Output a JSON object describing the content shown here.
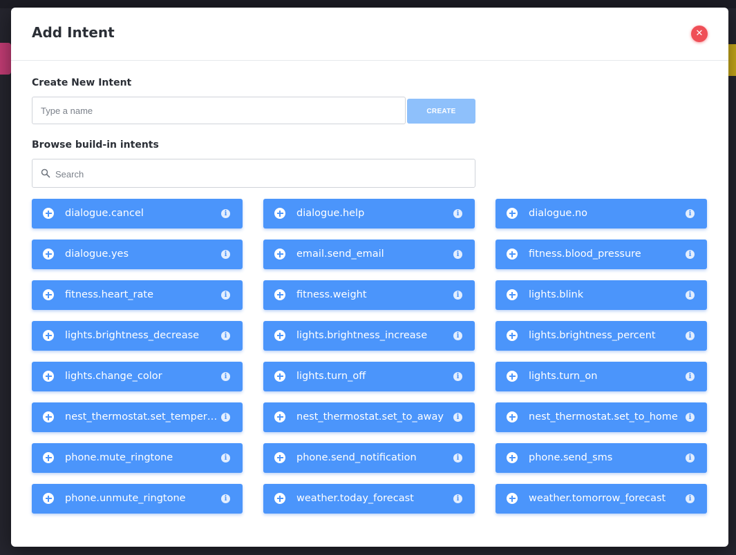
{
  "modal": {
    "title": "Add Intent",
    "close_icon": "close-icon",
    "create_section": {
      "label": "Create New Intent",
      "input_placeholder": "Type a name",
      "input_value": "",
      "button_label": "CREATE"
    },
    "browse_section": {
      "label": "Browse build-in intents",
      "search_placeholder": "Search",
      "search_value": "",
      "search_icon": "search-icon"
    },
    "intents": [
      {
        "label": "dialogue.cancel"
      },
      {
        "label": "dialogue.help"
      },
      {
        "label": "dialogue.no"
      },
      {
        "label": "dialogue.yes"
      },
      {
        "label": "email.send_email"
      },
      {
        "label": "fitness.blood_pressure"
      },
      {
        "label": "fitness.heart_rate"
      },
      {
        "label": "fitness.weight"
      },
      {
        "label": "lights.blink"
      },
      {
        "label": "lights.brightness_decrease"
      },
      {
        "label": "lights.brightness_increase"
      },
      {
        "label": "lights.brightness_percent"
      },
      {
        "label": "lights.change_color"
      },
      {
        "label": "lights.turn_off"
      },
      {
        "label": "lights.turn_on"
      },
      {
        "label": "nest_thermostat.set_temperat..."
      },
      {
        "label": "nest_thermostat.set_to_away"
      },
      {
        "label": "nest_thermostat.set_to_home"
      },
      {
        "label": "phone.mute_ringtone"
      },
      {
        "label": "phone.send_notification"
      },
      {
        "label": "phone.send_sms"
      },
      {
        "label": "phone.unmute_ringtone"
      },
      {
        "label": "weather.today_forecast"
      },
      {
        "label": "weather.tomorrow_forecast"
      }
    ],
    "intent_icons": {
      "add": "plus-circle-icon",
      "info": "info-icon"
    }
  },
  "colors": {
    "accent": "#4b95fb",
    "create_button": "#8ec0fb",
    "close": "#ef4f57"
  }
}
